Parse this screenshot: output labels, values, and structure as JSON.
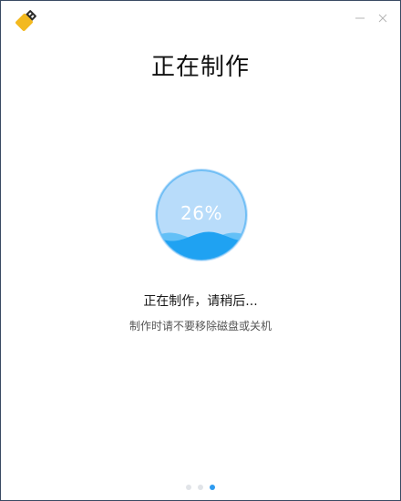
{
  "window": {
    "app_icon": "usb-drive-icon",
    "controls": {
      "minimize_icon": "minimize-icon",
      "close_icon": "close-icon"
    }
  },
  "main": {
    "title": "正在制作",
    "progress": {
      "percent_text": "26%",
      "value": 0.26
    },
    "status_text": "正在制作，请稍后...",
    "hint_text": "制作时请不要移除磁盘或关机"
  },
  "pager": {
    "total": 3,
    "active_index": 2
  },
  "colors": {
    "accent": "#2f9bf0",
    "circle_light": "#b8dcfa",
    "wave_front": "#1fa2f2",
    "wave_back": "#63c0f7",
    "icon_body": "#f3b91f",
    "icon_dark": "#2c2c2c"
  }
}
